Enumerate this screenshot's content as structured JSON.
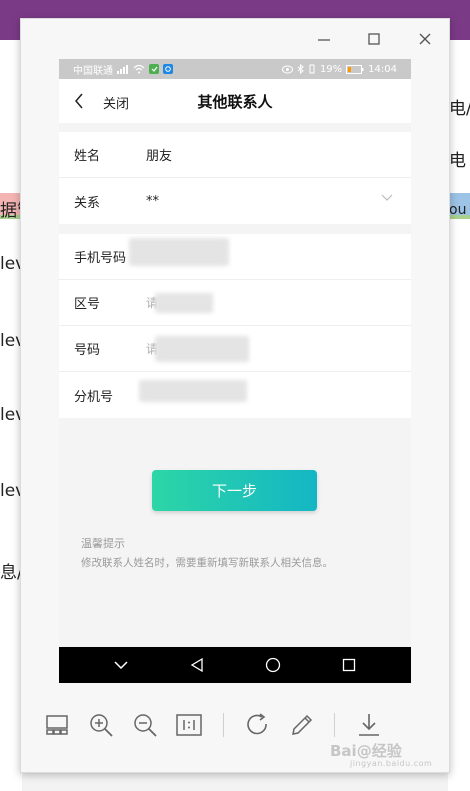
{
  "background": {
    "left_texts": [
      "据管",
      "lev",
      "lev",
      "lev",
      "lev",
      "息/"
    ],
    "right_texts": [
      "电/",
      "电",
      "ou"
    ]
  },
  "viewer": {
    "window_controls": {
      "minimize": "—",
      "maximize": "☐",
      "close": "✕"
    }
  },
  "phone": {
    "status_bar": {
      "carrier": "中国联通",
      "signal": "ᵘˡˡ",
      "battery": "19%",
      "time": "14:04"
    },
    "nav": {
      "close_label": "关闭",
      "title": "其他联系人"
    },
    "form": {
      "name_label": "姓名",
      "name_value": "朋友",
      "relation_label": "关系",
      "relation_value": "**",
      "mobile_label": "手机号码",
      "area_label": "区号",
      "area_placeholder": "请",
      "number_label": "号码",
      "number_placeholder": "请",
      "ext_label": "分机号"
    },
    "next_button": "下一步",
    "tip_title": "温馨提示",
    "tip_text": "修改联系人姓名时，需要重新填写新联系人相关信息。"
  },
  "watermark": {
    "main": "Bai@经验",
    "sub": "jingyan.baidu.com"
  },
  "colors": {
    "window_bg": "#7b3a86",
    "button_start": "#2dd6a6",
    "button_end": "#14b6c4"
  }
}
